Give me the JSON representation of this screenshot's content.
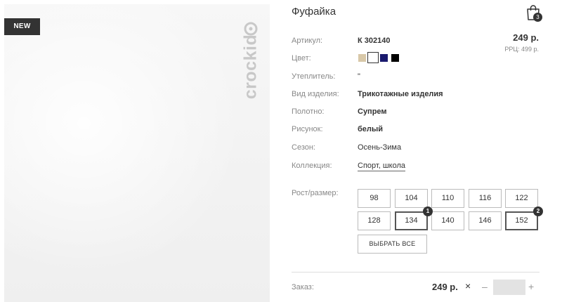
{
  "product": {
    "title": "Фуфайка",
    "badge": "NEW",
    "brand": "crockid",
    "price": "249 р.",
    "rrp": "РРЦ: 499 р."
  },
  "cart": {
    "count": "3",
    "icon": "shopping-bag-icon"
  },
  "specs": {
    "article": {
      "label": "Артикул:",
      "value": "К 302140"
    },
    "color": {
      "label": "Цвет:"
    },
    "insulation": {
      "label": "Утеплитель:",
      "value": "\""
    },
    "type": {
      "label": "Вид изделия:",
      "value": "Трикотажные изделия"
    },
    "fabric": {
      "label": "Полотно:",
      "value": "Супрем"
    },
    "pattern": {
      "label": "Рисунок:",
      "value": "белый"
    },
    "season": {
      "label": "Сезон:",
      "value": "Осень-Зима"
    },
    "collection": {
      "label": "Коллекция:",
      "value": "Спорт, школа"
    }
  },
  "colors": [
    {
      "name": "beige",
      "hex": "#d8c8a8",
      "selected": false
    },
    {
      "name": "white",
      "hex": "#ffffff",
      "selected": true
    },
    {
      "name": "navy",
      "hex": "#1a1a6e",
      "selected": false
    },
    {
      "name": "black",
      "hex": "#000000",
      "selected": false
    }
  ],
  "sizes": {
    "label": "Рост/размер:",
    "items": [
      {
        "label": "98",
        "count": null
      },
      {
        "label": "104",
        "count": null
      },
      {
        "label": "110",
        "count": null
      },
      {
        "label": "116",
        "count": null
      },
      {
        "label": "122",
        "count": null
      },
      {
        "label": "128",
        "count": null
      },
      {
        "label": "134",
        "count": "1"
      },
      {
        "label": "140",
        "count": null
      },
      {
        "label": "146",
        "count": null
      },
      {
        "label": "152",
        "count": "2"
      }
    ],
    "select_all": "ВЫБРАТЬ ВСЕ"
  },
  "order": {
    "label": "Заказ:",
    "price": "249 р.",
    "remove_icon": "×",
    "minus": "–",
    "plus": "+",
    "quantity": ""
  }
}
